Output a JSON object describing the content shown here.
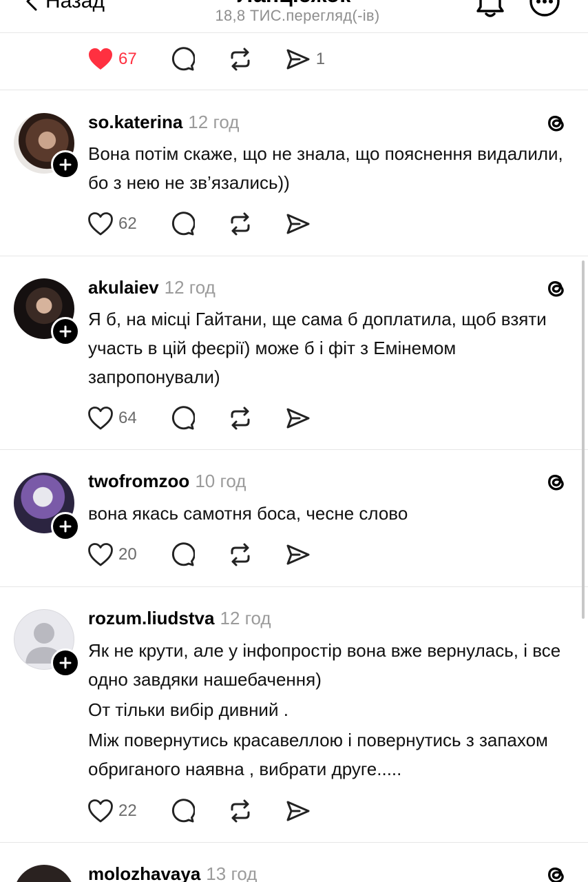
{
  "header": {
    "back_label": "Назад",
    "title": "Ланцюжок",
    "views": "18,8 ТИС.перегляд(-ів)"
  },
  "top_actions": {
    "likes": "67",
    "reposts_shares": "1"
  },
  "posts": [
    {
      "username": "so.katerina",
      "time": "12 год",
      "lines": [
        "Вона потім скаже, що не знала, що пояснення видалили, бо з нею не зв’язались))"
      ],
      "likes": "62"
    },
    {
      "username": "akulaiev",
      "time": "12 год",
      "lines": [
        "Я б, на місці Гайтани, ще сама б доплатила, щоб взяти участь в цій феєрії) може б і фіт з Емінемом запропонували)"
      ],
      "likes": "64"
    },
    {
      "username": "twofromzoo",
      "time": "10 год",
      "lines": [
        "вона якась самотня боса, чесне слово"
      ],
      "likes": "20"
    },
    {
      "username": "rozum.liudstva",
      "time": "12 год",
      "lines": [
        "Як не крути, але у інфопростір вона вже вернулась, і все одно завдяки нашебачення)",
        "От тільки вибір дивний .",
        "Між повернутись красавеллою і  повернутись з запахом обриганого наявна , вибрати друге....."
      ],
      "likes": "22"
    },
    {
      "username": "molozhavaya",
      "time": "13 год",
      "lines": [],
      "likes": ""
    }
  ],
  "colors": {
    "accent_red": "#ff3040",
    "muted": "#9b9b9b",
    "divider": "#e6e6e6"
  },
  "icons": [
    "chevron-left-icon",
    "bell-icon",
    "more-icon",
    "heart-icon",
    "comment-icon",
    "repost-icon",
    "share-icon",
    "threads-icon",
    "follow-plus-icon"
  ]
}
